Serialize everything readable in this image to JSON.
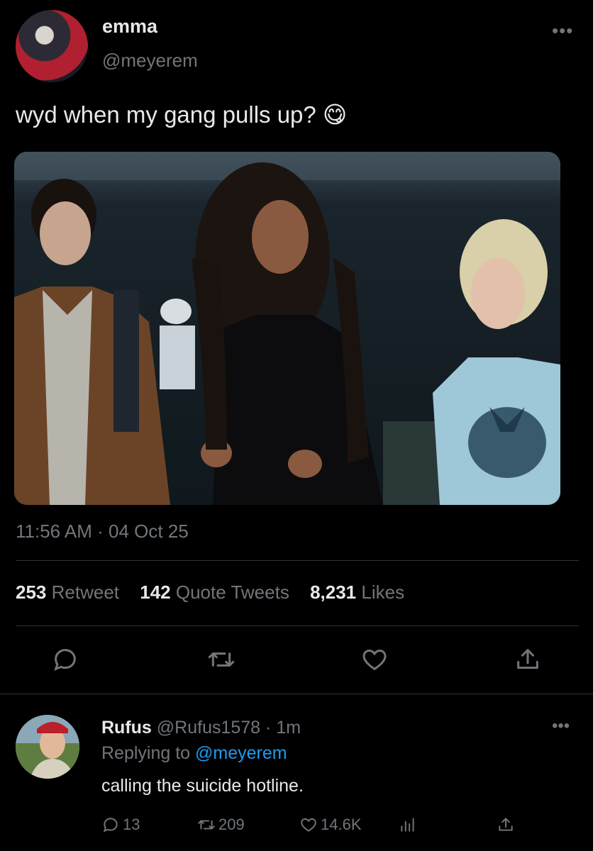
{
  "tweet": {
    "display_name": "emma",
    "handle": "@meyerem",
    "more_glyph": "•••",
    "text": "wyd when my gang pulls up?",
    "emoji": "😋",
    "timestamp": "11:56 AM · 04 Oct 25"
  },
  "stats": {
    "retweets_count": "253",
    "retweets_label": "Retweet",
    "quotes_count": "142",
    "quotes_label": "Quote Tweets",
    "likes_count": "8,231",
    "likes_label": "Likes"
  },
  "actions": [
    "reply-icon",
    "retweet-icon",
    "like-icon",
    "share-icon"
  ],
  "reply": {
    "display_name": "Rufus",
    "handle": "@Rufus1578",
    "time": "· 1m",
    "replying_prefix": "Replying to",
    "replying_to": "@meyerem",
    "text": "calling the suicide hotline.",
    "more_glyph": "•••",
    "reply_count": "13",
    "retweet_count": "209",
    "like_count": "14.6K"
  },
  "colors": {
    "background": "#000000",
    "text": "#e7e9ea",
    "muted": "#71767b",
    "link": "#1d9bf0",
    "divider": "#2f3336"
  }
}
